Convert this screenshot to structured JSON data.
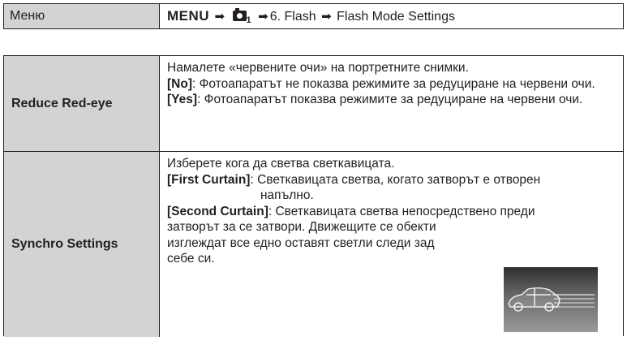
{
  "menu_row": {
    "label": "Меню",
    "path_menu": "MENU",
    "arrow": "➡",
    "cam_sub": "1",
    "path_rest": "6. Flash",
    "path_end": "Flash Mode Settings"
  },
  "rows": [
    {
      "name": "Reduce Red-eye",
      "lines": [
        {
          "bold": "",
          "text": "Намалете «червените очи» на портретните снимки."
        },
        {
          "bold": "[No]",
          "text": ": Фотоапаратът не показва режимите за редуциране на червени очи."
        },
        {
          "bold": "[Yes]",
          "text": ": Фотоапаратът показва режимите за редуциране на червени очи."
        }
      ]
    },
    {
      "name": "Synchro Settings",
      "intro": "Изберете кога да светва светкавицата.",
      "first_bold": "[First Curtain]",
      "first_text_a": ": Светкавицата светва, когато затворът е отворен",
      "first_text_b": "напълно.",
      "second_bold": "[Second Curtain]",
      "second_text_a": ": Светкавицата светва непосредствено преди",
      "second_text_b": "затворът за се затвори. Движещите се обекти",
      "second_text_c": "изглеждат все едно оставят светли следи зад",
      "second_text_d": "себе си."
    }
  ]
}
